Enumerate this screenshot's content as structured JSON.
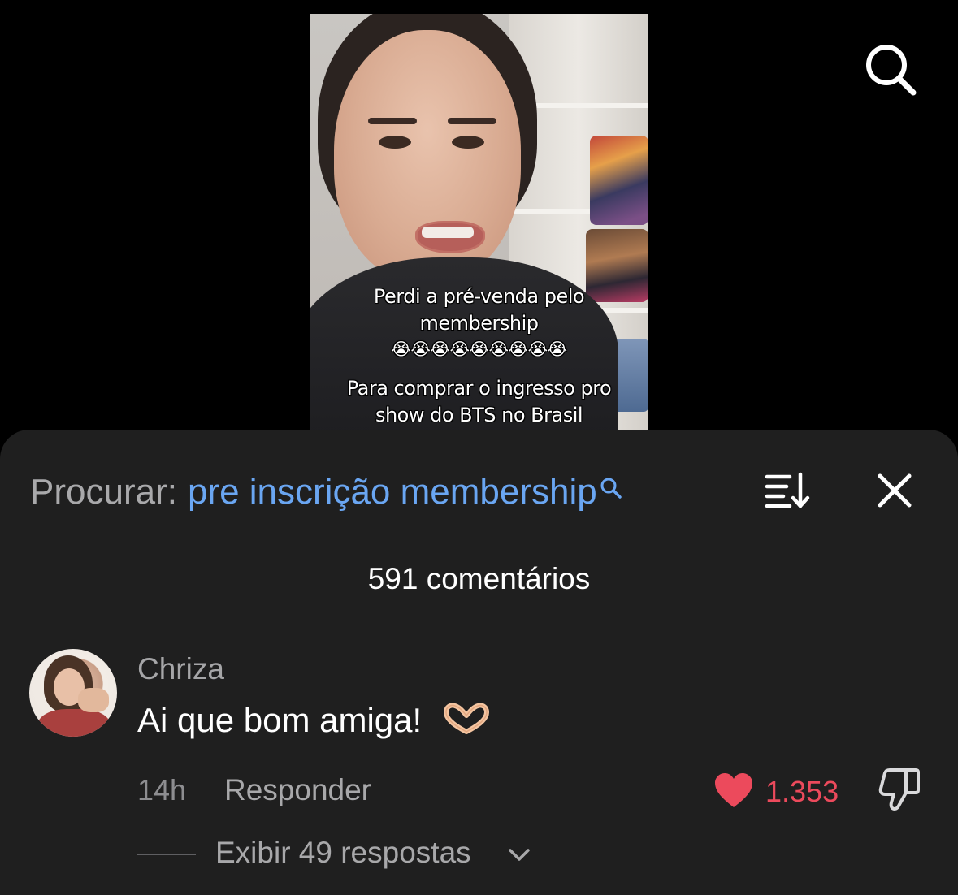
{
  "video": {
    "caption_line1": "Perdi a pré-venda pelo",
    "caption_line2": "membership",
    "caption_emoji": "😭😭😭😭😭😭😭😭😭",
    "caption_line3": "Para comprar o ingresso pro",
    "caption_line4": "show do BTS no Brasil"
  },
  "top_bar": {
    "search_icon": "search-icon"
  },
  "comments_panel": {
    "search_label": "Procurar:",
    "search_query": "pre inscrição membership",
    "sort_icon": "sort-icon",
    "close_icon": "close-icon",
    "comment_count": "591 comentários"
  },
  "comment": {
    "username": "Chriza",
    "text": "Ai que bom amiga!",
    "emoji_icon": "heart-hands-icon",
    "timestamp": "14h",
    "reply_label": "Responder",
    "like_count": "1.353",
    "replies_label": "Exibir 49 respostas"
  },
  "colors": {
    "sheet_background": "#1f1f1f",
    "query_blue": "#6aa6f2",
    "like_red": "#ec4a5c"
  }
}
